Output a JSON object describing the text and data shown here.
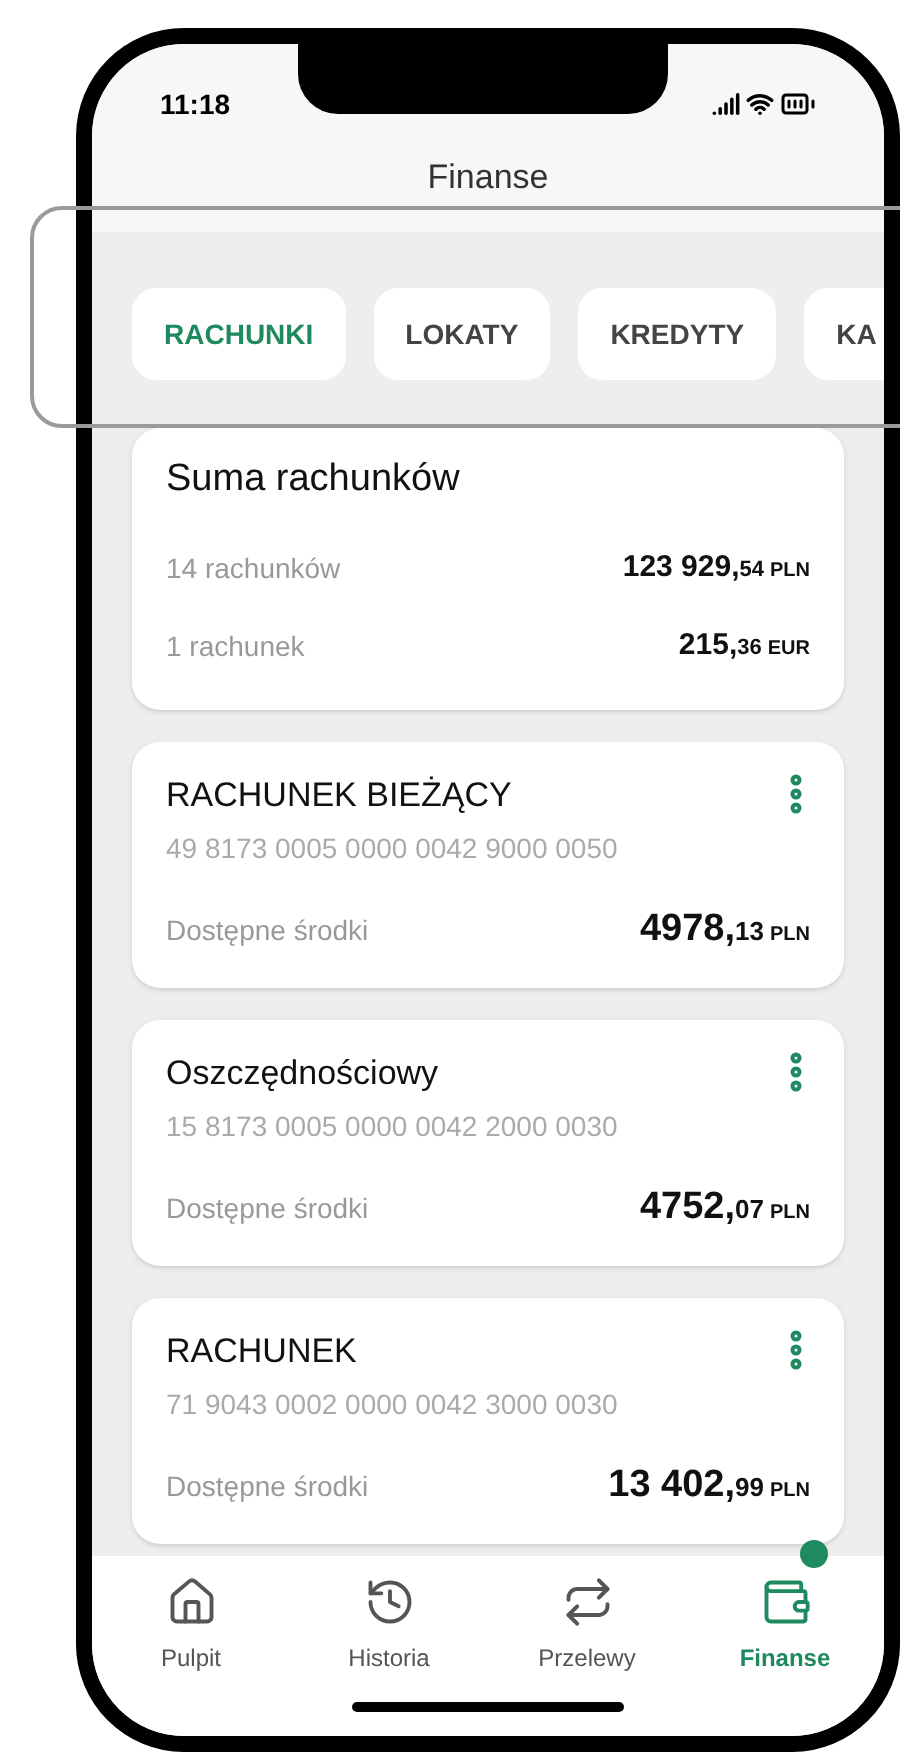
{
  "status_bar": {
    "time": "11:18"
  },
  "header": {
    "title": "Finanse"
  },
  "tabs": [
    {
      "label": "RACHUNKI",
      "selected": true
    },
    {
      "label": "LOKATY",
      "selected": false
    },
    {
      "label": "KREDYTY",
      "selected": false
    },
    {
      "label": "KA",
      "selected": false
    }
  ],
  "summary": {
    "title": "Suma rachunków",
    "rows": [
      {
        "label": "14 rachunków",
        "amount": "123 929,",
        "fraction": "54",
        "currency": "PLN"
      },
      {
        "label": "1 rachunek",
        "amount": "215,",
        "fraction": "36",
        "currency": "EUR"
      }
    ]
  },
  "accounts": [
    {
      "name": "RACHUNEK BIEŻĄCY",
      "number": "49 8173 0005 0000 0042 9000 0050",
      "balance_label": "Dostępne środki",
      "amount": "4978,",
      "fraction": "13",
      "currency": "PLN"
    },
    {
      "name": "Oszczędnościowy",
      "number": "15 8173 0005 0000 0042 2000 0030",
      "balance_label": "Dostępne środki",
      "amount": "4752,",
      "fraction": "07",
      "currency": "PLN"
    },
    {
      "name": "RACHUNEK",
      "number": "71 9043 0002 0000 0042 3000 0030",
      "balance_label": "Dostępne środki",
      "amount": "13 402,",
      "fraction": "99",
      "currency": "PLN"
    }
  ],
  "nav": [
    {
      "label": "Pulpit",
      "kind": "home",
      "selected": false
    },
    {
      "label": "Historia",
      "kind": "history",
      "selected": false
    },
    {
      "label": "Przelewy",
      "kind": "transfer",
      "selected": false
    },
    {
      "label": "Finanse",
      "kind": "wallet",
      "selected": true
    }
  ]
}
